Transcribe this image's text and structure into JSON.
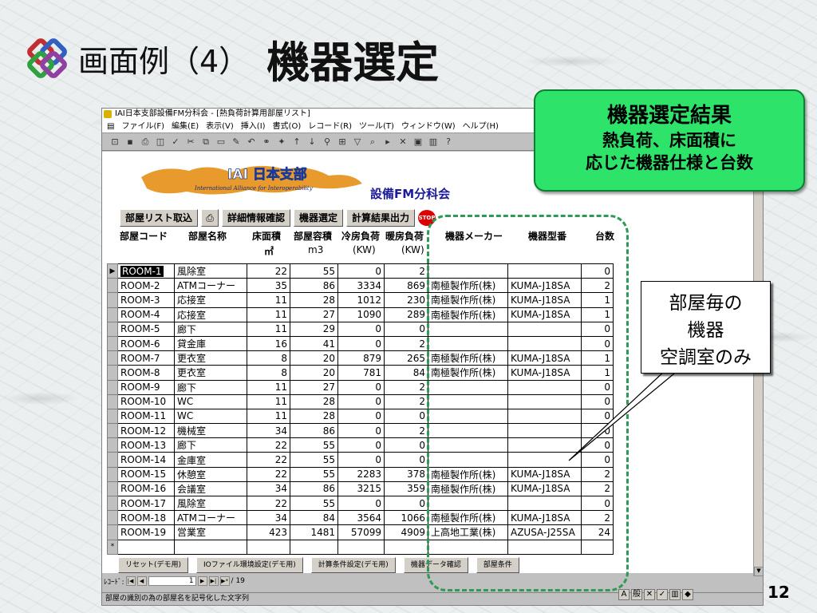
{
  "slide": {
    "title_prefix": "画面例（4）",
    "title_main": "機器選定",
    "page_number": "12"
  },
  "window": {
    "title": "IAI日本支部設備FM分科会 - [熱負荷計算用部屋リスト]",
    "menu": [
      "ファイル(F)",
      "編集(E)",
      "表示(V)",
      "挿入(I)",
      "書式(O)",
      "レコード(R)",
      "ツール(T)",
      "ウィンドウ(W)",
      "ヘルプ(H)"
    ]
  },
  "banner": {
    "logo_text": "IAI 日本支部",
    "logo_sub": "International Alliance for Interoperability",
    "subtitle": "設備FM分科会"
  },
  "buttons": {
    "import": "部屋リスト取込",
    "print_icon": "printer-icon",
    "detail": "詳細情報確認",
    "select": "機器選定",
    "output": "計算結果出力",
    "stop": "STOP"
  },
  "columns": {
    "code": "部屋コード",
    "name": "部屋名称",
    "area": "床面積",
    "area_unit": "㎡",
    "volume": "部屋容積",
    "volume_unit": "m3",
    "cool": "冷房負荷",
    "cool_unit": "(KW)",
    "heat": "暖房負荷",
    "heat_unit": "(KW)",
    "maker": "機器メーカー",
    "model": "機器型番",
    "count": "台数"
  },
  "rows": [
    {
      "code": "ROOM-1",
      "name": "風除室",
      "area": "22",
      "volume": "55",
      "cool": "0",
      "heat": "2",
      "maker": "",
      "model": "",
      "count": "0"
    },
    {
      "code": "ROOM-2",
      "name": "ATMコーナー",
      "area": "35",
      "volume": "86",
      "cool": "3334",
      "heat": "869",
      "maker": "南極製作所(株)",
      "model": "KUMA-J18SA",
      "count": "2"
    },
    {
      "code": "ROOM-3",
      "name": "応接室",
      "area": "11",
      "volume": "28",
      "cool": "1012",
      "heat": "230",
      "maker": "南極製作所(株)",
      "model": "KUMA-J18SA",
      "count": "1"
    },
    {
      "code": "ROOM-4",
      "name": "応接室",
      "area": "11",
      "volume": "27",
      "cool": "1090",
      "heat": "289",
      "maker": "南極製作所(株)",
      "model": "KUMA-J18SA",
      "count": "1"
    },
    {
      "code": "ROOM-5",
      "name": "廊下",
      "area": "11",
      "volume": "29",
      "cool": "0",
      "heat": "0",
      "maker": "",
      "model": "",
      "count": "0"
    },
    {
      "code": "ROOM-6",
      "name": "貸金庫",
      "area": "16",
      "volume": "41",
      "cool": "0",
      "heat": "2",
      "maker": "",
      "model": "",
      "count": "0"
    },
    {
      "code": "ROOM-7",
      "name": "更衣室",
      "area": "8",
      "volume": "20",
      "cool": "879",
      "heat": "265",
      "maker": "南極製作所(株)",
      "model": "KUMA-J18SA",
      "count": "1"
    },
    {
      "code": "ROOM-8",
      "name": "更衣室",
      "area": "8",
      "volume": "20",
      "cool": "781",
      "heat": "84",
      "maker": "南極製作所(株)",
      "model": "KUMA-J18SA",
      "count": "1"
    },
    {
      "code": "ROOM-9",
      "name": "廊下",
      "area": "11",
      "volume": "27",
      "cool": "0",
      "heat": "2",
      "maker": "",
      "model": "",
      "count": "0"
    },
    {
      "code": "ROOM-10",
      "name": "WC",
      "area": "11",
      "volume": "28",
      "cool": "0",
      "heat": "2",
      "maker": "",
      "model": "",
      "count": "0"
    },
    {
      "code": "ROOM-11",
      "name": "WC",
      "area": "11",
      "volume": "28",
      "cool": "0",
      "heat": "0",
      "maker": "",
      "model": "",
      "count": "0"
    },
    {
      "code": "ROOM-12",
      "name": "機械室",
      "area": "34",
      "volume": "86",
      "cool": "0",
      "heat": "2",
      "maker": "",
      "model": "",
      "count": "0"
    },
    {
      "code": "ROOM-13",
      "name": "廊下",
      "area": "22",
      "volume": "55",
      "cool": "0",
      "heat": "0",
      "maker": "",
      "model": "",
      "count": "0"
    },
    {
      "code": "ROOM-14",
      "name": "金庫室",
      "area": "22",
      "volume": "55",
      "cool": "0",
      "heat": "0",
      "maker": "",
      "model": "",
      "count": "0"
    },
    {
      "code": "ROOM-15",
      "name": "休憩室",
      "area": "22",
      "volume": "55",
      "cool": "2283",
      "heat": "378",
      "maker": "南極製作所(株)",
      "model": "KUMA-J18SA",
      "count": "2"
    },
    {
      "code": "ROOM-16",
      "name": "会議室",
      "area": "34",
      "volume": "86",
      "cool": "3215",
      "heat": "359",
      "maker": "南極製作所(株)",
      "model": "KUMA-J18SA",
      "count": "2"
    },
    {
      "code": "ROOM-17",
      "name": "風除室",
      "area": "22",
      "volume": "55",
      "cool": "0",
      "heat": "0",
      "maker": "",
      "model": "",
      "count": "0"
    },
    {
      "code": "ROOM-18",
      "name": "ATMコーナー",
      "area": "34",
      "volume": "84",
      "cool": "3564",
      "heat": "1066",
      "maker": "南極製作所(株)",
      "model": "KUMA-J18SA",
      "count": "2"
    },
    {
      "code": "ROOM-19",
      "name": "営業室",
      "area": "423",
      "volume": "1481",
      "cool": "57099",
      "heat": "4909",
      "maker": "上高地工業(株)",
      "model": "AZUSA-J25SA",
      "count": "24"
    }
  ],
  "bottom_buttons": [
    "リセット(デモ用)",
    "IOファイル環境設定(デモ用)",
    "計算条件設定(デモ用)",
    "機器データ確認",
    "部屋条件"
  ],
  "record_nav": {
    "label": "ﾚｺｰﾄﾞ:",
    "current": "1",
    "total": "/ 19"
  },
  "statusbar": "部屋の識別の為の部屋名を記号化した文字列",
  "callout_green": {
    "line1": "機器選定結果",
    "line2": "熱負荷、床面積に",
    "line3": "応じた機器仕様と台数"
  },
  "callout_white": {
    "line1": "部屋毎の",
    "line2": "機器",
    "line3": "空調室のみ"
  }
}
